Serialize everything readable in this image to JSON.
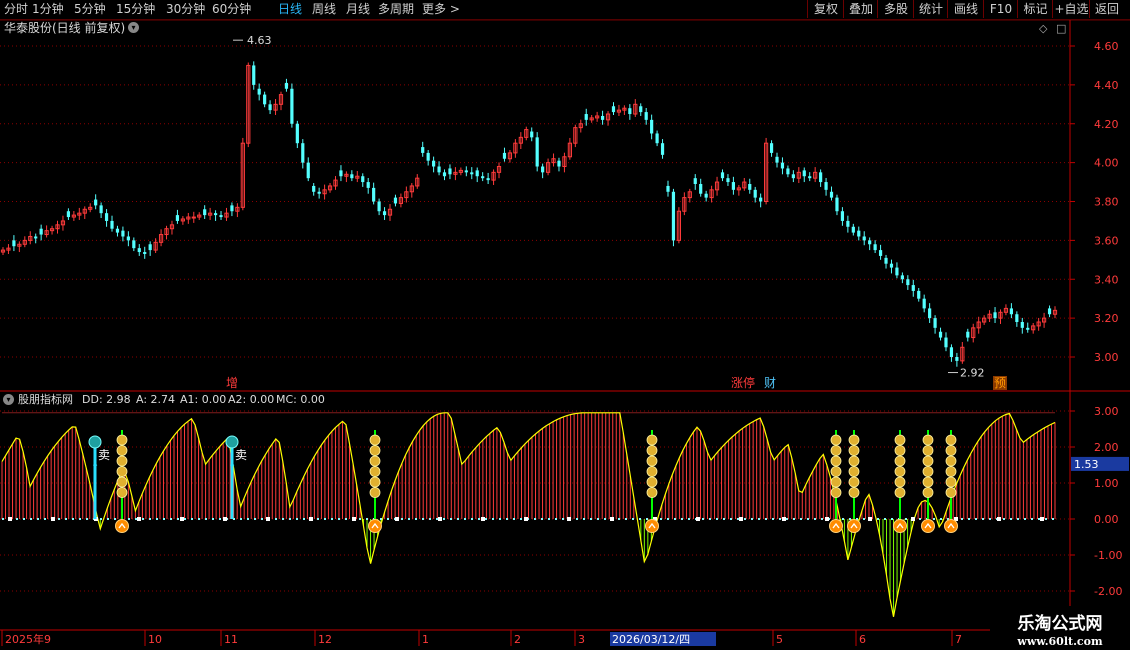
{
  "toolbar": {
    "tabs": [
      "分时",
      "1分钟",
      "5分钟",
      "15分钟",
      "30分钟",
      "60分钟",
      "日线",
      "周线",
      "月线",
      "多周期",
      "更多 >"
    ],
    "active_tab": "日线",
    "right_buttons": [
      "复权",
      "叠加",
      "多股",
      "统计",
      "画线",
      "F10",
      "标记",
      "+自选",
      "返回"
    ]
  },
  "main_chart": {
    "title": "华泰股份(日线 前复权)",
    "high_label": "4.63",
    "low_label": "2.92",
    "y_ticks": [
      "4.60",
      "4.40",
      "4.20",
      "4.00",
      "3.80",
      "3.60",
      "3.40",
      "3.20",
      "3.00"
    ],
    "markers": [
      {
        "text": "增",
        "color": "#ff3b3b"
      },
      {
        "text": "涨停",
        "color": "#ff3b3b"
      },
      {
        "text": "财",
        "color": "#4fc3f7"
      },
      {
        "text": "预",
        "color": "#ff9800"
      }
    ]
  },
  "indicator": {
    "name": "股朋指标网",
    "values": [
      {
        "label": "DD: 2.98",
        "color": "#ff3b3b"
      },
      {
        "label": "A: 2.74",
        "color": "#ffff00"
      },
      {
        "label": "A1: 0.00",
        "color": "#00ff00"
      },
      {
        "label": "A2: 0.00",
        "color": "#00ff00"
      },
      {
        "label": "MC: 0.00",
        "color": "#cccccc"
      }
    ],
    "y_ticks": [
      "3.00",
      "2.00",
      "1.00",
      "0.00",
      "-1.00",
      "-2.00"
    ],
    "current_value": "1.53",
    "sell_label": "卖"
  },
  "time_axis": {
    "labels": [
      "2025年9",
      "10",
      "11",
      "12",
      "1",
      "2",
      "3",
      "2026/03/12/四",
      "5",
      "6",
      "7"
    ]
  },
  "watermark": {
    "line1": "乐淘公式网",
    "line2": "www.60lt.com"
  },
  "colors": {
    "up": "#ff3b3b",
    "down": "#54ffff",
    "grid": "#8b0000",
    "axis": "#c00000"
  },
  "chart_data": {
    "type": "candlestick",
    "title": "华泰股份(日线 前复权)",
    "ylim": [
      2.85,
      4.72
    ],
    "close_series_approx": [
      3.55,
      3.56,
      3.57,
      3.58,
      3.6,
      3.62,
      3.61,
      3.63,
      3.65,
      3.66,
      3.68,
      3.7,
      3.72,
      3.73,
      3.74,
      3.76,
      3.77,
      3.78,
      3.74,
      3.7,
      3.66,
      3.64,
      3.62,
      3.6,
      3.56,
      3.54,
      3.53,
      3.55,
      3.59,
      3.63,
      3.66,
      3.68,
      3.7,
      3.71,
      3.72,
      3.72,
      3.73,
      3.73,
      3.74,
      3.73,
      3.72,
      3.74,
      3.75,
      3.77,
      4.1,
      4.5,
      4.4,
      4.35,
      4.3,
      4.27,
      4.3,
      4.35,
      4.38,
      4.2,
      4.1,
      4.0,
      3.92,
      3.85,
      3.84,
      3.86,
      3.88,
      3.91,
      3.93,
      3.94,
      3.92,
      3.93,
      3.9,
      3.87,
      3.8,
      3.75,
      3.73,
      3.76,
      3.79,
      3.82,
      3.85,
      3.88,
      3.92,
      4.05,
      4.01,
      3.98,
      3.95,
      3.93,
      3.94,
      3.95,
      3.96,
      3.95,
      3.94,
      3.93,
      3.92,
      3.91,
      3.95,
      3.98,
      4.02,
      4.05,
      4.1,
      4.13,
      4.17,
      4.13,
      3.98,
      3.95,
      4.0,
      4.02,
      3.98,
      4.03,
      4.1,
      4.18,
      4.2,
      4.22,
      4.23,
      4.24,
      4.22,
      4.25,
      4.26,
      4.27,
      4.28,
      4.25,
      4.3,
      4.26,
      4.22,
      4.15,
      4.1,
      4.04,
      3.85,
      3.6,
      3.75,
      3.82,
      3.85,
      3.89,
      3.84,
      3.82,
      3.86,
      3.9,
      3.92,
      3.9,
      3.86,
      3.87,
      3.9,
      3.86,
      3.82,
      3.8,
      4.1,
      4.05,
      4.0,
      3.97,
      3.94,
      3.92,
      3.95,
      3.93,
      3.92,
      3.95,
      3.9,
      3.86,
      3.82,
      3.75,
      3.7,
      3.67,
      3.64,
      3.62,
      3.6,
      3.58,
      3.55,
      3.52,
      3.48,
      3.46,
      3.42,
      3.4,
      3.37,
      3.34,
      3.3,
      3.25,
      3.2,
      3.15,
      3.1,
      3.05,
      3.0,
      2.98,
      3.05,
      3.1,
      3.15,
      3.18,
      3.2,
      3.22,
      3.2,
      3.23,
      3.25,
      3.22,
      3.18,
      3.15,
      3.14,
      3.16,
      3.18,
      3.2,
      3.22,
      3.24
    ],
    "indicator": {
      "DD": 2.98,
      "A": 2.74,
      "A1": 0.0,
      "A2": 0.0,
      "MC": 0.0,
      "ylim": [
        -2.2,
        3.2
      ]
    }
  }
}
